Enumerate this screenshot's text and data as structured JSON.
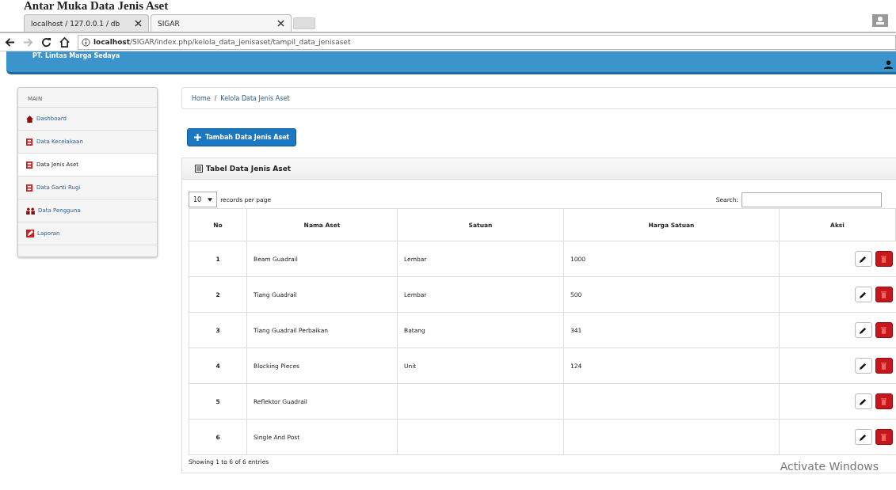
{
  "caption": "Antar Muka Data Jenis Aset",
  "browser": {
    "tabs": [
      {
        "title": "localhost / 127.0.0.1 / db",
        "selected": false
      },
      {
        "title": "SIGAR",
        "selected": true
      }
    ],
    "address": {
      "host": "localhost",
      "path": "/SIGAR/index.php/kelola_data_jenisaset/tampil_data_jenisaset"
    }
  },
  "header": {
    "brand": "PT. Lintas Marga Sedaya"
  },
  "sidebar": {
    "heading": "MAIN",
    "items": [
      {
        "label": "Dashboard",
        "kind": "home",
        "selected": false
      },
      {
        "label": "Data Kecelakaan",
        "kind": "doc",
        "selected": false
      },
      {
        "label": "Data Jenis Aset",
        "kind": "doc",
        "selected": true
      },
      {
        "label": "Data Ganti Rugi",
        "kind": "doc",
        "selected": false
      },
      {
        "label": "Data Pengguna",
        "kind": "users",
        "selected": false
      },
      {
        "label": "Laporan",
        "kind": "edit",
        "selected": false
      }
    ]
  },
  "breadcrumb": [
    "Home",
    "/",
    "Kelola Data Jenis Aset"
  ],
  "add_button": "Tambah Data Jenis Aset",
  "panel": {
    "title": "Tabel Data Jenis Aset",
    "page_size": "10",
    "page_size_label": "records per page",
    "search_label": "Search:",
    "columns": [
      "No",
      "Nama Aset",
      "Satuan",
      "Harga Satuan",
      "Aksi"
    ],
    "rows": [
      [
        "1",
        "Beam Guadrail",
        "Lembar",
        "1000"
      ],
      [
        "2",
        "Tiang Guadrail",
        "Lembar",
        "500"
      ],
      [
        "3",
        "Tiang Guadrail Perbaikan",
        "Batang",
        "341"
      ],
      [
        "4",
        "Blocking Pieces",
        "Unit",
        "124"
      ],
      [
        "5",
        "Reflektor Guadrail",
        "",
        ""
      ],
      [
        "6",
        "Single And Post",
        "",
        ""
      ]
    ],
    "info": "Showing 1 to 6 of 6 entries"
  },
  "os_notice": "Activate Windows"
}
